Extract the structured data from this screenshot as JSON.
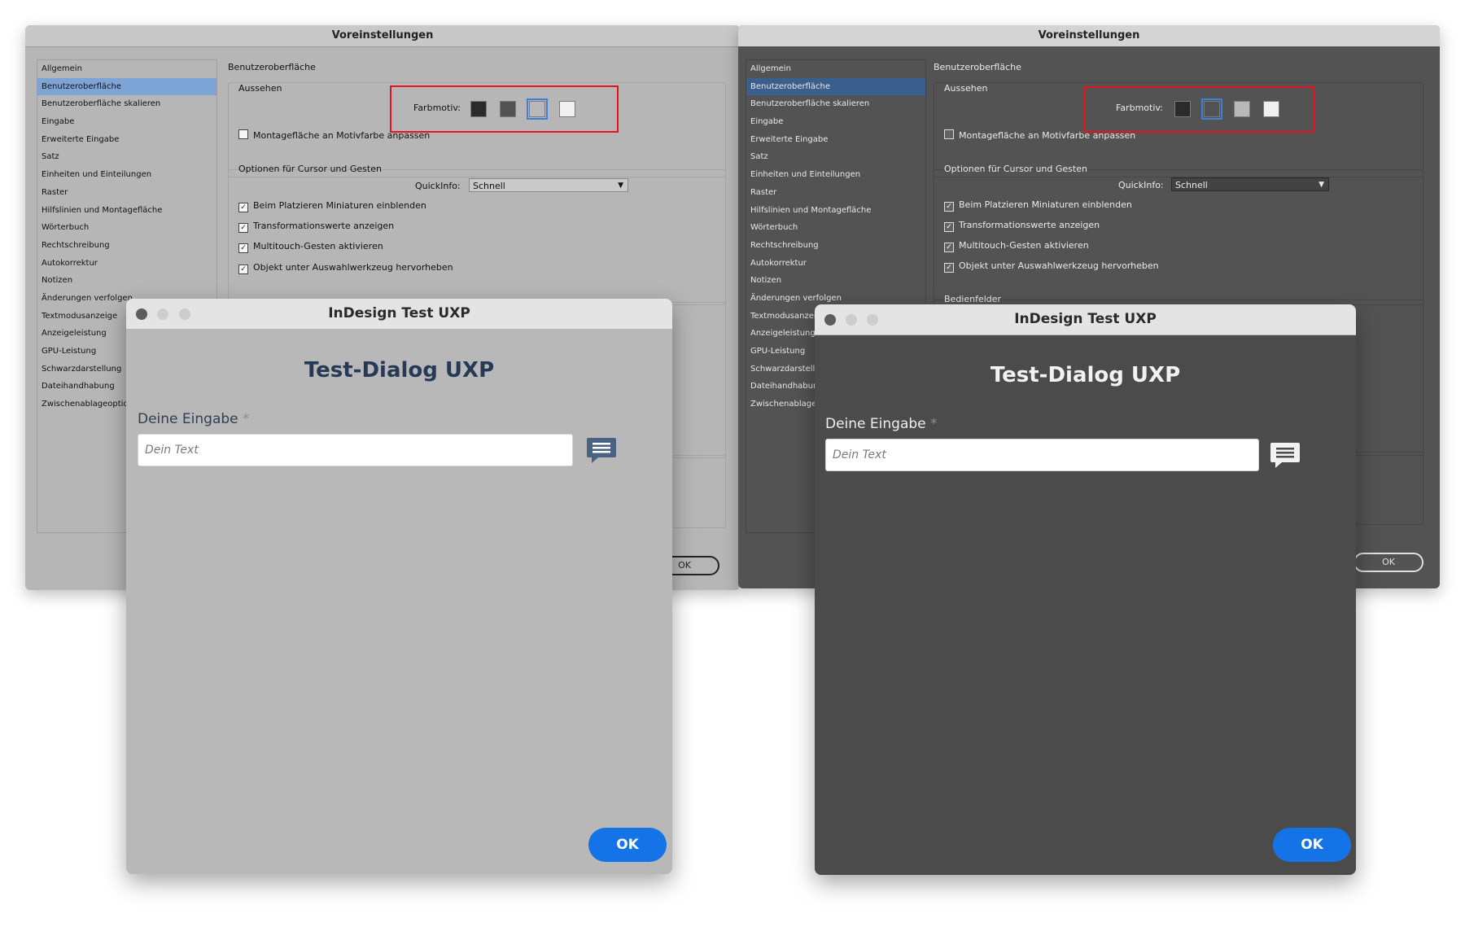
{
  "prefs_window": {
    "title": "Voreinstellungen",
    "nav_items": [
      "Allgemein",
      "Benutzeroberfläche",
      "Benutzeroberfläche skalieren",
      "Eingabe",
      "Erweiterte Eingabe",
      "Satz",
      "Einheiten und Einteilungen",
      "Raster",
      "Hilfslinien und Montagefläche",
      "Wörterbuch",
      "Rechtschreibung",
      "Autokorrektur",
      "Notizen",
      "Änderungen verfolgen",
      "Textmodusanzeige",
      "Anzeigeleistung",
      "GPU-Leistung",
      "Schwarzdarstellung",
      "Dateihandhabung",
      "Zwischenablageoptionen"
    ],
    "selected_nav": "Benutzeroberfläche",
    "pane_title": "Benutzeroberfläche",
    "appearance_group": "Aussehen",
    "color_theme_label": "Farbmotiv:",
    "color_themes": [
      "#2b2b2b",
      "#535353",
      "#b8b8b8",
      "#f0f0f0"
    ],
    "pasteboard_option": "Montagefläche an Motivfarbe anpassen",
    "cursor_group": "Optionen für Cursor und Gesten",
    "quickinfo_label": "QuickInfo:",
    "quickinfo_value": "Schnell",
    "options": [
      "Beim Platzieren Miniaturen einblenden",
      "Transformationswerte anzeigen",
      "Multitouch-Gesten aktivieren",
      "Objekt unter Auswahlwerkzeug hervorheben"
    ],
    "panels_group": "Bedienfelder",
    "ok_label": "OK"
  },
  "dialog": {
    "title": "InDesign Test UXP",
    "heading": "Test-Dialog UXP",
    "field_label": "Deine Eingabe",
    "required_marker": "*",
    "placeholder": "Dein Text",
    "ok_label": "OK"
  },
  "colors": {
    "highlight_box": "#e8121c",
    "accent": "#1473e6",
    "selected_swatch_outline": "#3d7fd9"
  }
}
